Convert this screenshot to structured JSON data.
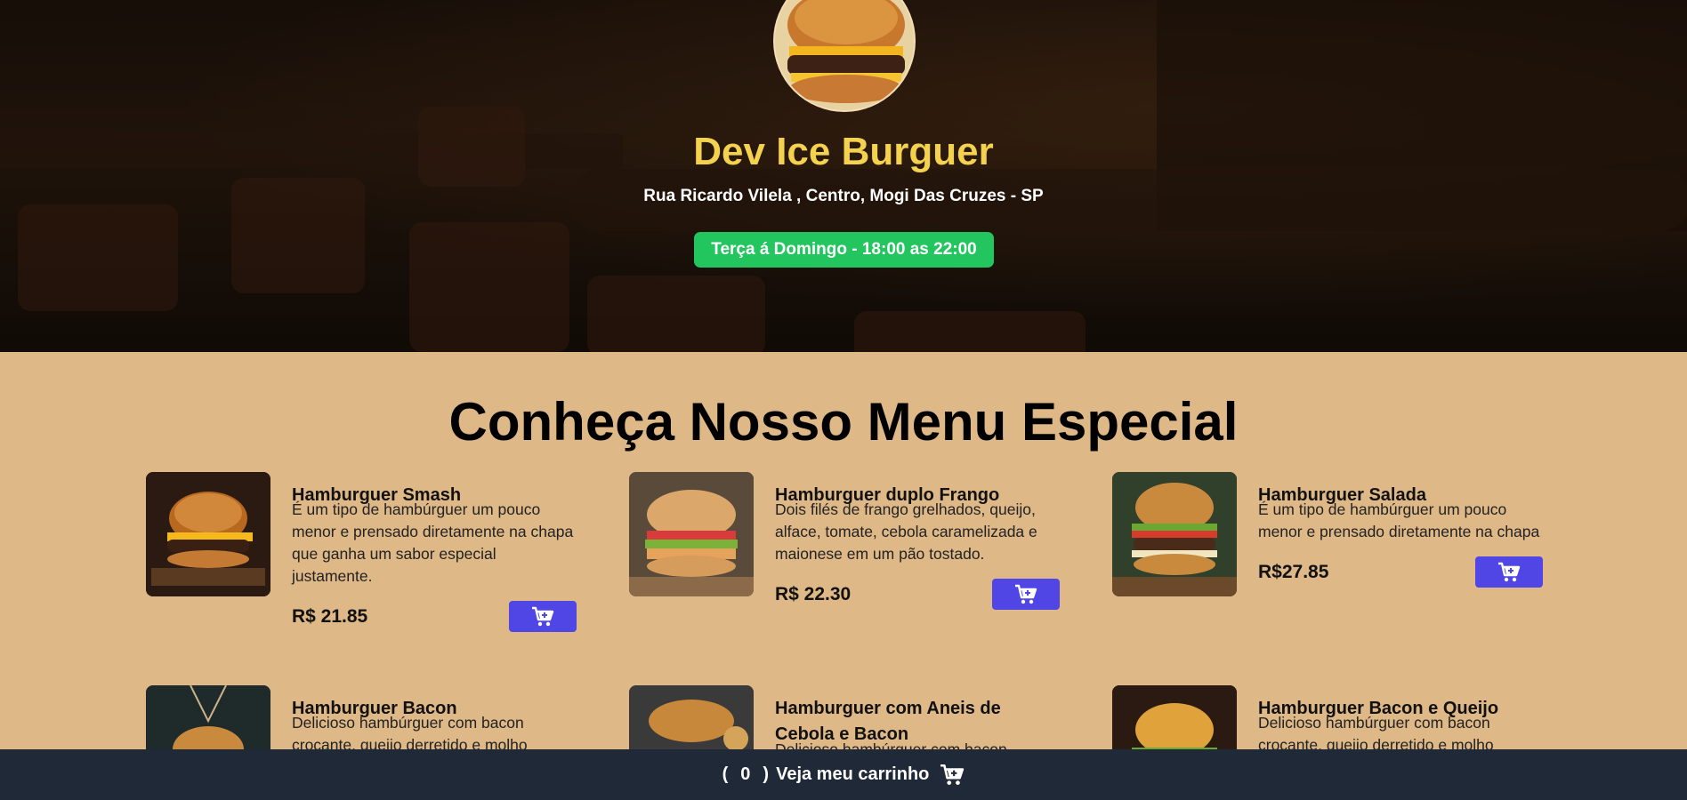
{
  "header": {
    "title": "Dev Ice Burguer",
    "address": "Rua Ricardo Vilela , Centro, Mogi Das Cruzes - SP",
    "hours": "Terça á Domingo - 18:00 as 22:00",
    "title_color": "#f5d24e",
    "hours_badge_color": "#22c55e"
  },
  "menu": {
    "title": "Conheça Nosso Menu Especial",
    "items": [
      {
        "name": "Hamburguer Smash",
        "description": "É um tipo de hambúrguer um pouco menor e prensado diretamente na chapa que ganha um sabor especial justamente.",
        "price": "R$ 21.85"
      },
      {
        "name": "Hamburguer duplo Frango",
        "description": "Dois filés de frango grelhados, queijo, alface, tomate, cebola caramelizada e maionese em um pão tostado.",
        "price": "R$ 22.30"
      },
      {
        "name": "Hamburguer Salada",
        "description": "É um tipo de hambúrguer um pouco menor e prensado diretamente na chapa",
        "price": "R$27.85"
      },
      {
        "name": "Hamburguer Bacon",
        "description": "Delicioso hambúrguer com bacon crocante, queijo derretido e molho",
        "price": ""
      },
      {
        "name": "Hamburguer com Aneis de Cebola e Bacon",
        "description": "Delicioso hambúrguer com bacon",
        "price": ""
      },
      {
        "name": "Hamburguer Bacon e Queijo",
        "description": "Delicioso hambúrguer com bacon crocante, queijo derretido e molho",
        "price": ""
      }
    ],
    "add_to_cart_icon": "cart-plus-icon",
    "button_color": "#4f46e5",
    "background_color": "#dfb887"
  },
  "footer": {
    "cart_count_open": "(",
    "cart_count": "0",
    "cart_count_close": ")",
    "cart_label": "Veja meu carrinho",
    "cart_icon": "cart-plus-icon",
    "background_color": "#1f2937"
  }
}
